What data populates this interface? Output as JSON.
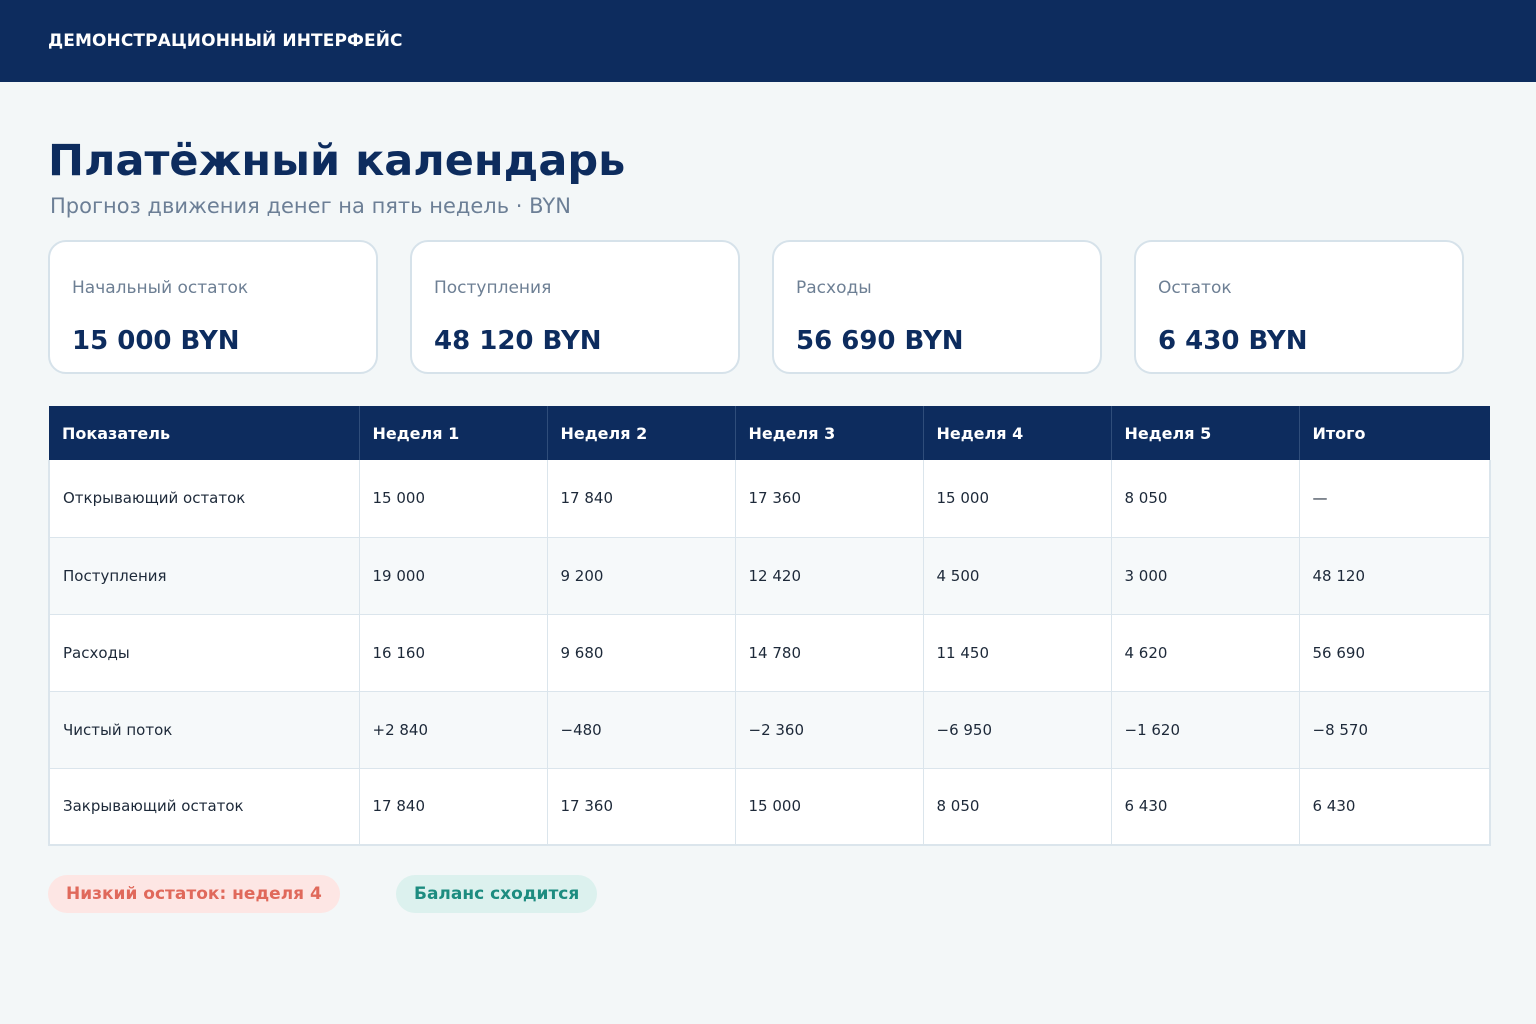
{
  "header": {
    "app_title": "ДЕМОНСТРАЦИОННЫЙ ИНТЕРФЕЙС"
  },
  "page": {
    "title": "Платёжный календарь",
    "subtitle": "Прогноз движения денег на пять недель · BYN"
  },
  "summary_cards": [
    {
      "label": "Начальный остаток",
      "value": "15 000 BYN"
    },
    {
      "label": "Поступления",
      "value": "48 120 BYN"
    },
    {
      "label": "Расходы",
      "value": "56 690 BYN"
    },
    {
      "label": "Остаток",
      "value": "6 430 BYN"
    }
  ],
  "table": {
    "columns": [
      "Показатель",
      "Неделя 1",
      "Неделя 2",
      "Неделя 3",
      "Неделя 4",
      "Неделя 5",
      "Итого"
    ],
    "rows": [
      [
        "Открывающий остаток",
        "15 000",
        "17 840",
        "17 360",
        "15 000",
        "8 050",
        "—"
      ],
      [
        "Поступления",
        "19 000",
        "9 200",
        "12 420",
        "4 500",
        "3 000",
        "48 120"
      ],
      [
        "Расходы",
        "16 160",
        "9 680",
        "14 780",
        "11 450",
        "4 620",
        "56 690"
      ],
      [
        "Чистый поток",
        "+2 840",
        "−480",
        "−2 360",
        "−6 950",
        "−1 620",
        "−8 570"
      ],
      [
        "Закрывающий остаток",
        "17 840",
        "17 360",
        "15 000",
        "8 050",
        "6 430",
        "6 430"
      ]
    ]
  },
  "status": {
    "warning": "Низкий остаток: неделя 4",
    "ok": "Баланс сходится"
  },
  "colors": {
    "header_bg": "#0d2c5e",
    "page_bg": "#f3f7f8",
    "warning_bg": "#fde6e4",
    "warning_text": "#e0695b",
    "ok_bg": "#dcf1ee",
    "ok_text": "#1d8c80"
  }
}
